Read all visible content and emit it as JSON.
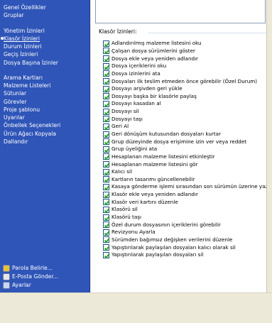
{
  "sidebar": {
    "items": [
      {
        "label": "Genel Özellikler",
        "selected": false
      },
      {
        "label": "Gruplar",
        "selected": false
      },
      {
        "label": "Yönetim İzinleri",
        "selected": false
      },
      {
        "label": "Klasör İzinleri",
        "selected": true
      },
      {
        "label": "Durum İzinleri",
        "selected": false
      },
      {
        "label": "Geçiş İzinleri",
        "selected": false
      },
      {
        "label": "Dosya Başına İzinler",
        "selected": false
      },
      {
        "label": "Arama Kartları",
        "selected": false
      },
      {
        "label": "Malzeme Listeleri",
        "selected": false
      },
      {
        "label": "Sütunlar",
        "selected": false
      },
      {
        "label": "Görevler",
        "selected": false
      },
      {
        "label": "Proje şablonu",
        "selected": false
      },
      {
        "label": "Uyarılar",
        "selected": false
      },
      {
        "label": "Önbellek Seçenekleri",
        "selected": false
      },
      {
        "label": "Ürün Ağacı Kopyala",
        "selected": false
      },
      {
        "label": "Dallandır",
        "selected": false
      }
    ],
    "bottom_links": [
      {
        "label": "Parola Belirle...",
        "icon": "key-icon"
      },
      {
        "label": "E-Posta Gönder...",
        "icon": "email-icon"
      },
      {
        "label": "Ayarlar",
        "icon": "settings-icon"
      }
    ]
  },
  "main": {
    "group_label": "Klasör İzinleri:",
    "permissions": [
      "Adlandırılmış malzeme listesini oku",
      "Çalışan dosya sürümlerini göster",
      "Dosya ekle veya yeniden adlandır",
      "Dosya içeriklerini oku",
      "Dosya izinlerini ata",
      "Dosyaları ilk teslim etmeden önce görebilir (Özel Durum)",
      "Dosyayı arşivden geri yükle",
      "Dosyayı başka bir klasörle paylaş",
      "Dosyayı kasadan al",
      "Dosyayı sil",
      "Dosyayı taşı",
      "Geri Al",
      "Geri dönüşüm kutusundan dosyaları kurtar",
      "Grup düzeyinde dosya erişimine izin ver veya reddet",
      "Grup üyeliğini ata",
      "Hesaplanan malzeme listesini etkinleştir",
      "Hesaplanan malzeme listesini gör",
      "Kalıcı sil",
      "Kartların tasarımı güncellenebilir",
      "Kasaya gönderme işlemi sırasından son sürümün üzerine yazabilir",
      "Klasör ekle veya yeniden adlandır",
      "Klasör veri kartını düzenle",
      "Klasörü sil",
      "Klasörü taşı",
      "Özel durum dosyasının içeriklerini görebilir",
      "Revizyonu Ayarla",
      "Sürümden bağımsız değişken verilerini düzenle",
      "Yapıştırılarak paylaşılan dosyaları kalıcı olarak sil",
      "Yapıştırılarak paylaşılan dosyaları sil"
    ],
    "checked": true
  },
  "colors": {
    "sidebar_bg": "#2f55b8",
    "check_green": "#21a121"
  }
}
